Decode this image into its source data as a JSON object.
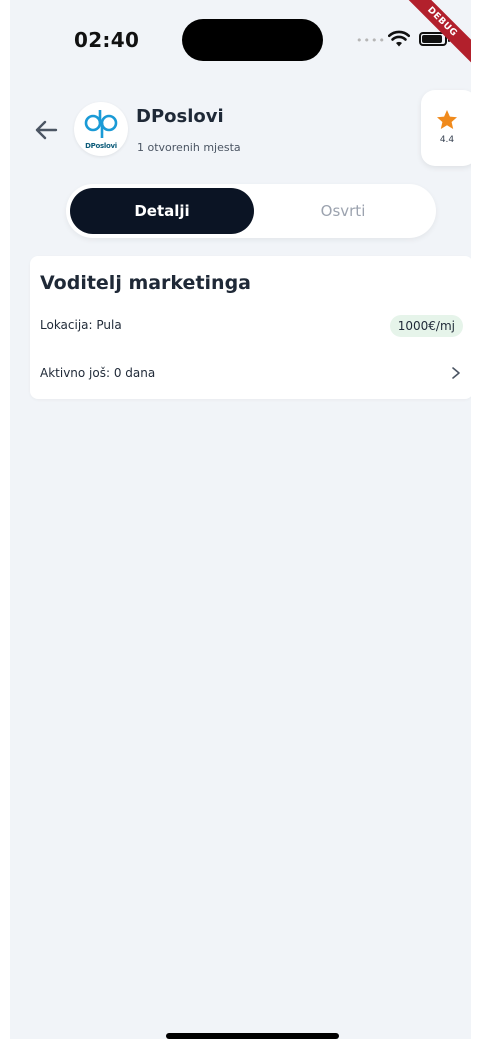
{
  "status_bar": {
    "time": "02:40"
  },
  "debug_banner": "DEBUG",
  "header": {
    "company_name": "DPoslovi",
    "open_positions": "1 otvorenih mjesta",
    "logo_text": "DPoslovi",
    "rating": "4.4",
    "icons": {
      "back": "arrow-left-icon",
      "rating": "star-icon"
    },
    "colors": {
      "star": "#f08a1c",
      "logo": "#1a9ad6"
    }
  },
  "tabs": [
    {
      "label": "Detalji",
      "active": true
    },
    {
      "label": "Osvrti",
      "active": false
    }
  ],
  "job": {
    "title": "Voditelj marketinga",
    "location": "Lokacija: Pula",
    "salary": "1000€/mj",
    "active": "Aktivno još: 0 dana"
  },
  "colors": {
    "active_tab": "#0b1424",
    "salary_badge": "#e6f4ea",
    "background": "#f1f4f8"
  }
}
